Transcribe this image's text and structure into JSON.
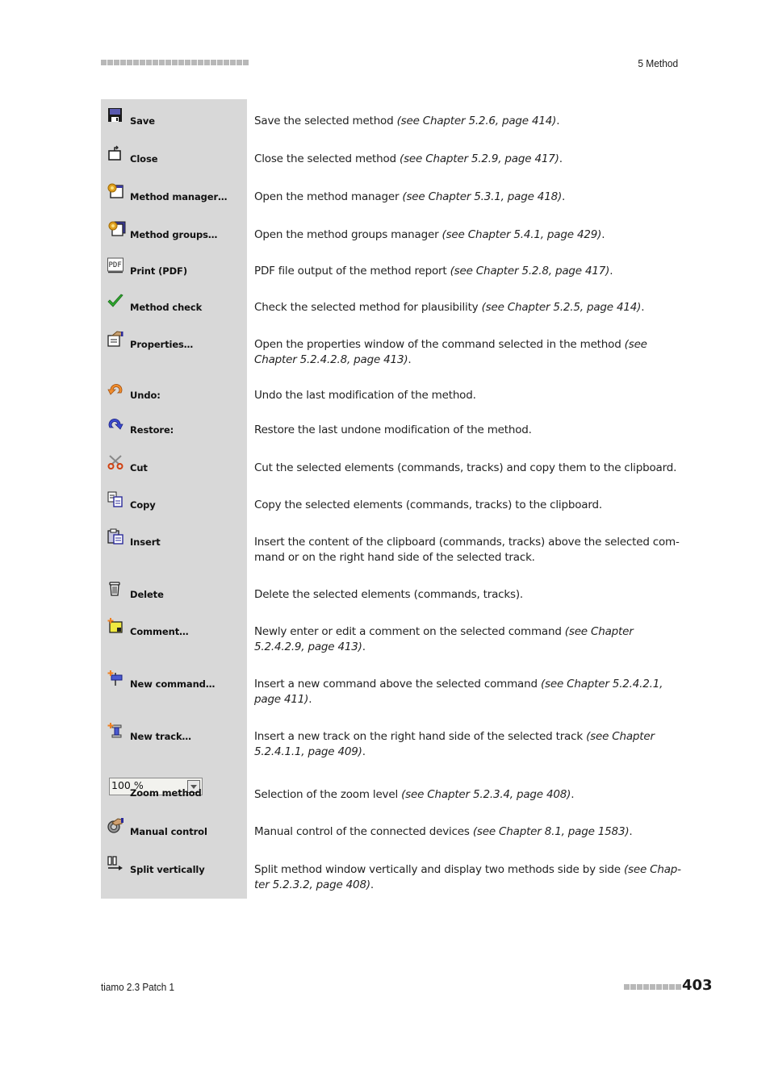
{
  "header": {
    "chapter": "5 Method",
    "decor_squares": 23
  },
  "rows": [
    {
      "icon": "save-icon",
      "label": "Save",
      "desc": "Save the selected method ",
      "ref": "(see Chapter 5.2.6, page 414)",
      "tail": "."
    },
    {
      "icon": "close-icon",
      "label": "Close",
      "desc": "Close the selected method ",
      "ref": "(see Chapter 5.2.9, page 417)",
      "tail": "."
    },
    {
      "icon": "method-manager-icon",
      "label": "Method manager…",
      "desc": "Open the method manager ",
      "ref": "(see Chapter 5.3.1, page 418)",
      "tail": "."
    },
    {
      "icon": "method-groups-icon",
      "label": "Method groups…",
      "desc": "Open the method groups manager ",
      "ref": "(see Chapter 5.4.1, page 429)",
      "tail": "."
    },
    {
      "icon": "pdf-icon",
      "label": "Print (PDF)",
      "desc": "PDF file output of the method report ",
      "ref": "(see Chapter 5.2.8, page 417)",
      "tail": "."
    },
    {
      "icon": "check-icon",
      "label": "Method check",
      "desc": "Check the selected method for plausibility ",
      "ref": "(see Chapter 5.2.5, page 414)",
      "tail": "."
    },
    {
      "icon": "properties-icon",
      "label": "Properties…",
      "desc": "Open the properties window of the command selected in the method ",
      "ref": "(see Chapter 5.2.4.2.8, page 413)",
      "tail": "."
    },
    {
      "icon": "undo-icon",
      "label": "Undo:",
      "desc": "Undo the last modification of the method.",
      "ref": "",
      "tail": ""
    },
    {
      "icon": "restore-icon",
      "label": "Restore:",
      "desc": "Restore the last undone modification of the method.",
      "ref": "",
      "tail": ""
    },
    {
      "icon": "cut-icon",
      "label": "Cut",
      "desc": "Cut the selected elements (commands, tracks) and copy them to the clipboard.",
      "ref": "",
      "tail": ""
    },
    {
      "icon": "copy-icon",
      "label": "Copy",
      "desc": "Copy the selected elements (commands, tracks) to the clipboard.",
      "ref": "",
      "tail": ""
    },
    {
      "icon": "insert-icon",
      "label": "Insert",
      "desc": "Insert the content of the clipboard (commands, tracks) above the selected com-mand or on the right hand side of the selected track.",
      "ref": "",
      "tail": ""
    },
    {
      "icon": "delete-icon",
      "label": "Delete",
      "desc": "Delete the selected elements (commands, tracks).",
      "ref": "",
      "tail": ""
    },
    {
      "icon": "comment-icon",
      "label": "Comment…",
      "desc": "Newly enter or edit a comment on the selected command ",
      "ref": "(see Chapter 5.2.4.2.9, page 413)",
      "tail": "."
    },
    {
      "icon": "new-command-icon",
      "label": "New command…",
      "desc": "Insert a new command above the selected command ",
      "ref": "(see Chapter 5.2.4.2.1, page 411)",
      "tail": "."
    },
    {
      "icon": "new-track-icon",
      "label": "New track…",
      "desc": "Insert a new track on the right hand side of the selected track ",
      "ref": "(see Chapter 5.2.4.1.1, page 409)",
      "tail": "."
    },
    {
      "icon": "zoom-select",
      "label": "Zoom method",
      "zoom_value": "100 %",
      "desc": "Selection of the zoom level ",
      "ref": "(see Chapter 5.2.3.4, page 408)",
      "tail": "."
    },
    {
      "icon": "manual-control-icon",
      "label": "Manual control",
      "desc": "Manual control of the connected devices ",
      "ref": "(see Chapter 8.1, page 1583)",
      "tail": "."
    },
    {
      "icon": "split-vertically-icon",
      "label": "Split vertically",
      "desc": "Split method window vertically and display two methods side by side ",
      "ref": "(see Chap-ter 5.2.3.2, page 408)",
      "tail": "."
    }
  ],
  "footer": {
    "product": "tiamo 2.3 Patch 1",
    "page_number": "403",
    "decor_squares": 9
  }
}
